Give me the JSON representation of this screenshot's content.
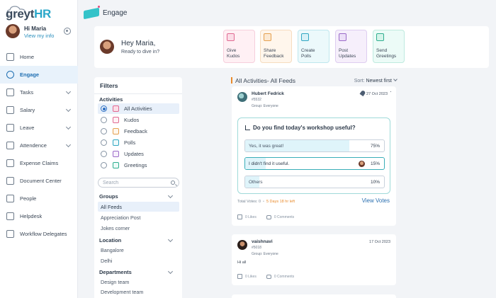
{
  "app": {
    "logo": {
      "part1": "greyt",
      "part2": "HR"
    },
    "page_title": "Engage"
  },
  "user": {
    "greeting": "Hi Maria",
    "view_info": "View my info"
  },
  "sidebar": {
    "items": [
      {
        "label": "Home",
        "icon": "home-icon",
        "chevron": false
      },
      {
        "label": "Engage",
        "icon": "engage-icon",
        "chevron": false,
        "active": true
      },
      {
        "label": "Tasks",
        "icon": "tasks-icon",
        "chevron": true
      },
      {
        "label": "Salary",
        "icon": "salary-icon",
        "chevron": true
      },
      {
        "label": "Leave",
        "icon": "leave-icon",
        "chevron": true
      },
      {
        "label": "Attendence",
        "icon": "attendance-icon",
        "chevron": true
      },
      {
        "label": "Expense Claims",
        "icon": "expense-icon",
        "chevron": false
      },
      {
        "label": "Document Center",
        "icon": "document-icon",
        "chevron": false
      },
      {
        "label": "People",
        "icon": "people-icon",
        "chevron": false
      },
      {
        "label": "Helpdesk",
        "icon": "helpdesk-icon",
        "chevron": false
      },
      {
        "label": "Workflow Delegates",
        "icon": "workflow-icon",
        "chevron": false
      }
    ]
  },
  "greeting_card": {
    "hey": "Hey Maria,",
    "sub": "Ready to dive in?",
    "actions": [
      {
        "line1": "Give",
        "line2": "Kudos",
        "icon": "kudos-icon",
        "color": "#e06a92"
      },
      {
        "line1": "Share",
        "line2": "Feedback",
        "icon": "feedback-icon",
        "color": "#e5a04f"
      },
      {
        "line1": "Create",
        "line2": "Polls",
        "icon": "polls-icon",
        "color": "#31a7c2"
      },
      {
        "line1": "Post",
        "line2": "Updates",
        "icon": "updates-icon",
        "color": "#9b6bc8"
      },
      {
        "line1": "Send",
        "line2": "Greetings",
        "icon": "greetings-icon",
        "color": "#2fae8f"
      }
    ]
  },
  "filters": {
    "title": "Filters",
    "activities_label": "Activities",
    "activities": [
      {
        "label": "All Activities",
        "selected": true,
        "icon": "all-activities-icon",
        "color": "#e06a92"
      },
      {
        "label": "Kudos",
        "selected": false,
        "icon": "kudos-icon",
        "color": "#e06a92"
      },
      {
        "label": "Feedback",
        "selected": false,
        "icon": "feedback-icon",
        "color": "#e5a04f"
      },
      {
        "label": "Polls",
        "selected": false,
        "icon": "polls-icon",
        "color": "#31a7c2"
      },
      {
        "label": "Updates",
        "selected": false,
        "icon": "updates-icon",
        "color": "#9b6bc8"
      },
      {
        "label": "Greetings",
        "selected": false,
        "icon": "greetings-icon",
        "color": "#2fae8f"
      }
    ],
    "search_placeholder": "Search",
    "groups_label": "Groups",
    "groups": [
      "All Feeds",
      "Appreciation Post",
      "Jokes corner"
    ],
    "location_label": "Location",
    "locations": [
      "Bangalore",
      "Delhi"
    ],
    "departments_label": "Departments",
    "departments": [
      "Design team",
      "Development team"
    ]
  },
  "feeds": {
    "title": "All Activities- All Feeds",
    "sort_label": "Sort:",
    "sort_value": "Newest first"
  },
  "post1": {
    "name": "Hubert Fedrick",
    "id": "#5532",
    "group": "Group: Everyone",
    "date": "27 Oct 2023",
    "question": "Do you find today's workshop useful?",
    "options": [
      {
        "label": "Yes, it was great!",
        "pct_text": "75%",
        "pct": 75,
        "chosen": false
      },
      {
        "label": "I didn't find it useful.",
        "pct_text": "15%",
        "pct": 15,
        "chosen": true
      },
      {
        "label": "Others",
        "pct_text": "10%",
        "pct": 10,
        "chosen": false
      }
    ],
    "total_votes": "Total Votes: 0",
    "days_left": "5 Days 18 hr left",
    "view_votes": "View Votes",
    "likes": "0 Likes",
    "comments": "0 Comments"
  },
  "post2": {
    "name": "vaishnavi",
    "id": "#5018",
    "group": "Group: Everyone",
    "date": "17 Oct 2023",
    "message": "Hi all",
    "likes": "0 Likes",
    "comments": "0 Comments"
  }
}
